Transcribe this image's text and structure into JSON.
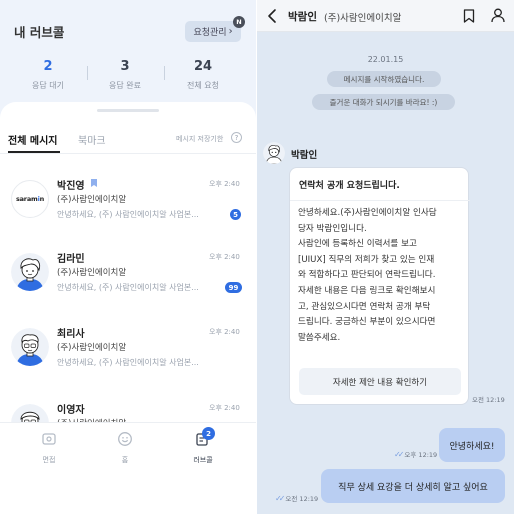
{
  "inbox": {
    "title": "내 러브콜",
    "request_manage_label": "요청관리",
    "request_manage_chevron": "›",
    "new_badge": "N",
    "stats": [
      {
        "value": "2",
        "label": "응답 대기"
      },
      {
        "value": "3",
        "label": "응답 완료"
      },
      {
        "value": "24",
        "label": "전체 요청"
      }
    ],
    "tabs": {
      "all": "전체 메시지",
      "bookmark": "북마크"
    },
    "save_info": "메시지 저장기한",
    "help_icon_text": "?",
    "messages": [
      {
        "name": "박진영",
        "time": "오후 2:40",
        "company": "(주)사람인에이치알",
        "preview": "안녕하세요, (주) 사람인에이치알 사업본...",
        "unread": "5",
        "avatar": "saramin-logo",
        "logo_text_a": "saram",
        "logo_text_b": "i",
        "logo_text_c": "n"
      },
      {
        "name": "김라민",
        "time": "오후 2:40",
        "company": "(주)사람인에이치알",
        "preview": "안녕하세요, (주) 사람인에이치알 사업본...",
        "unread": "99",
        "avatar": "person-avatar"
      },
      {
        "name": "최리사",
        "time": "오후 2:40",
        "company": "(주)사람인에이치알",
        "preview": "안녕하세요, (주) 사람인에이치알 사업본...",
        "unread": "",
        "avatar": "person-avatar"
      },
      {
        "name": "이영자",
        "time": "오후 2:40",
        "company": "(주)사람인에이치알",
        "preview": "",
        "unread": "",
        "avatar": "person-avatar"
      }
    ],
    "bottom_nav": [
      {
        "label": "면접",
        "icon": "interview-icon"
      },
      {
        "label": "홈",
        "icon": "smile-icon"
      },
      {
        "label": "러브콜",
        "icon": "lovecall-icon",
        "badge": "2"
      }
    ]
  },
  "chat": {
    "header_name": "박람인",
    "header_company": "(주)사람인에이치알",
    "date": "22.01.15",
    "system_messages": [
      "메시지를 시작하였습니다.",
      "즐거운 대화가 되시기를 바라요! :)"
    ],
    "sender_name": "박람인",
    "bubble_title": "연락처 공개 요청드립니다.",
    "bubble_body": "안녕하세요.(주)사람인에이치알 인사담\n당자 박람인입니다.\n사람인에 등록하신 이력서를 보고\n[UIUX] 직무의 저희가 찾고 있는 인재\n와 적합하다고 판단되어 연락드립니다.\n자세한 내용은 다음 링크로 확인해보시\n고, 관심있으시다면 연락처 공개 부탁\n드립니다. 궁금하신 부분이 있으시다면\n말씀주세요.",
    "bubble_button": "자세한 제안 내용 확인하기",
    "bubble_time": "오전 12:19",
    "my_messages": [
      {
        "text": "안녕하세요!",
        "time": "오후 12:19"
      },
      {
        "text": "직무 상세 요강을 더 상세히 알고 싶어요",
        "time": "오전 12:19"
      }
    ],
    "read_mark": "✓✓",
    "colors": {
      "accent": "#2f6de1",
      "my_bubble": "#b9cef2",
      "chat_bg": "#dfe8f3"
    }
  }
}
